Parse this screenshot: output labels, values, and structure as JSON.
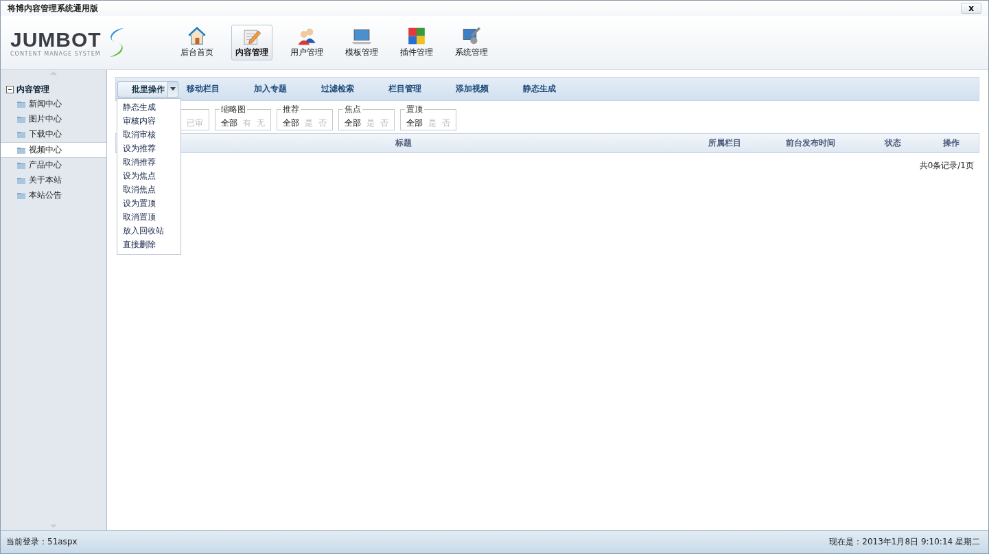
{
  "window": {
    "title": "将博内容管理系统通用版",
    "close": "x"
  },
  "logo": {
    "name": "JUMBOT",
    "tagline": "CONTENT MANAGE SYSTEM"
  },
  "nav": [
    {
      "label": "后台首页",
      "selected": false
    },
    {
      "label": "内容管理",
      "selected": true
    },
    {
      "label": "用户管理",
      "selected": false
    },
    {
      "label": "模板管理",
      "selected": false
    },
    {
      "label": "插件管理",
      "selected": false
    },
    {
      "label": "系统管理",
      "selected": false
    }
  ],
  "sidebar": {
    "root": {
      "label": "内容管理",
      "expanded": true,
      "children": [
        {
          "label": "新闻中心",
          "selected": false
        },
        {
          "label": "图片中心",
          "selected": false
        },
        {
          "label": "下载中心",
          "selected": false
        },
        {
          "label": "视频中心",
          "selected": true
        },
        {
          "label": "产品中心",
          "selected": false
        },
        {
          "label": "关于本站",
          "selected": false
        },
        {
          "label": "本站公告",
          "selected": false
        }
      ]
    }
  },
  "toolbar": {
    "batch": {
      "label": "批里操作",
      "expanded": true,
      "menu": [
        "静态生成",
        "审核内容",
        "取消审核",
        "设为推荐",
        "取消推荐",
        "设为焦点",
        "取消焦点",
        "设为置顶",
        "取消置顶",
        "放入回收站",
        "直接删除"
      ]
    },
    "actions": [
      "移动栏目",
      "加入专题",
      "过滤检索",
      "栏目管理",
      "添加视频",
      "静态生成"
    ]
  },
  "filters": [
    {
      "options": [
        {
          "label": "已审",
          "selected": false
        }
      ]
    },
    {
      "legend": "缩略图",
      "options": [
        {
          "label": "全部",
          "selected": true
        },
        {
          "label": "有",
          "selected": false
        },
        {
          "label": "无",
          "selected": false
        }
      ]
    },
    {
      "legend": "推荐",
      "options": [
        {
          "label": "全部",
          "selected": true
        },
        {
          "label": "是",
          "selected": false
        },
        {
          "label": "否",
          "selected": false
        }
      ]
    },
    {
      "legend": "焦点",
      "options": [
        {
          "label": "全部",
          "selected": true
        },
        {
          "label": "是",
          "selected": false
        },
        {
          "label": "否",
          "selected": false
        }
      ]
    },
    {
      "legend": "置顶",
      "options": [
        {
          "label": "全部",
          "selected": true
        },
        {
          "label": "是",
          "selected": false
        },
        {
          "label": "否",
          "selected": false
        }
      ]
    }
  ],
  "table": {
    "columns": [
      "标题",
      "所属栏目",
      "前台发布时间",
      "状态",
      "操作"
    ],
    "pager": "共0条记录/1页"
  },
  "status_bar": {
    "login": "当前登录：51aspx",
    "time": "现在是：2013年1月8日 9:10:14 星期二"
  }
}
